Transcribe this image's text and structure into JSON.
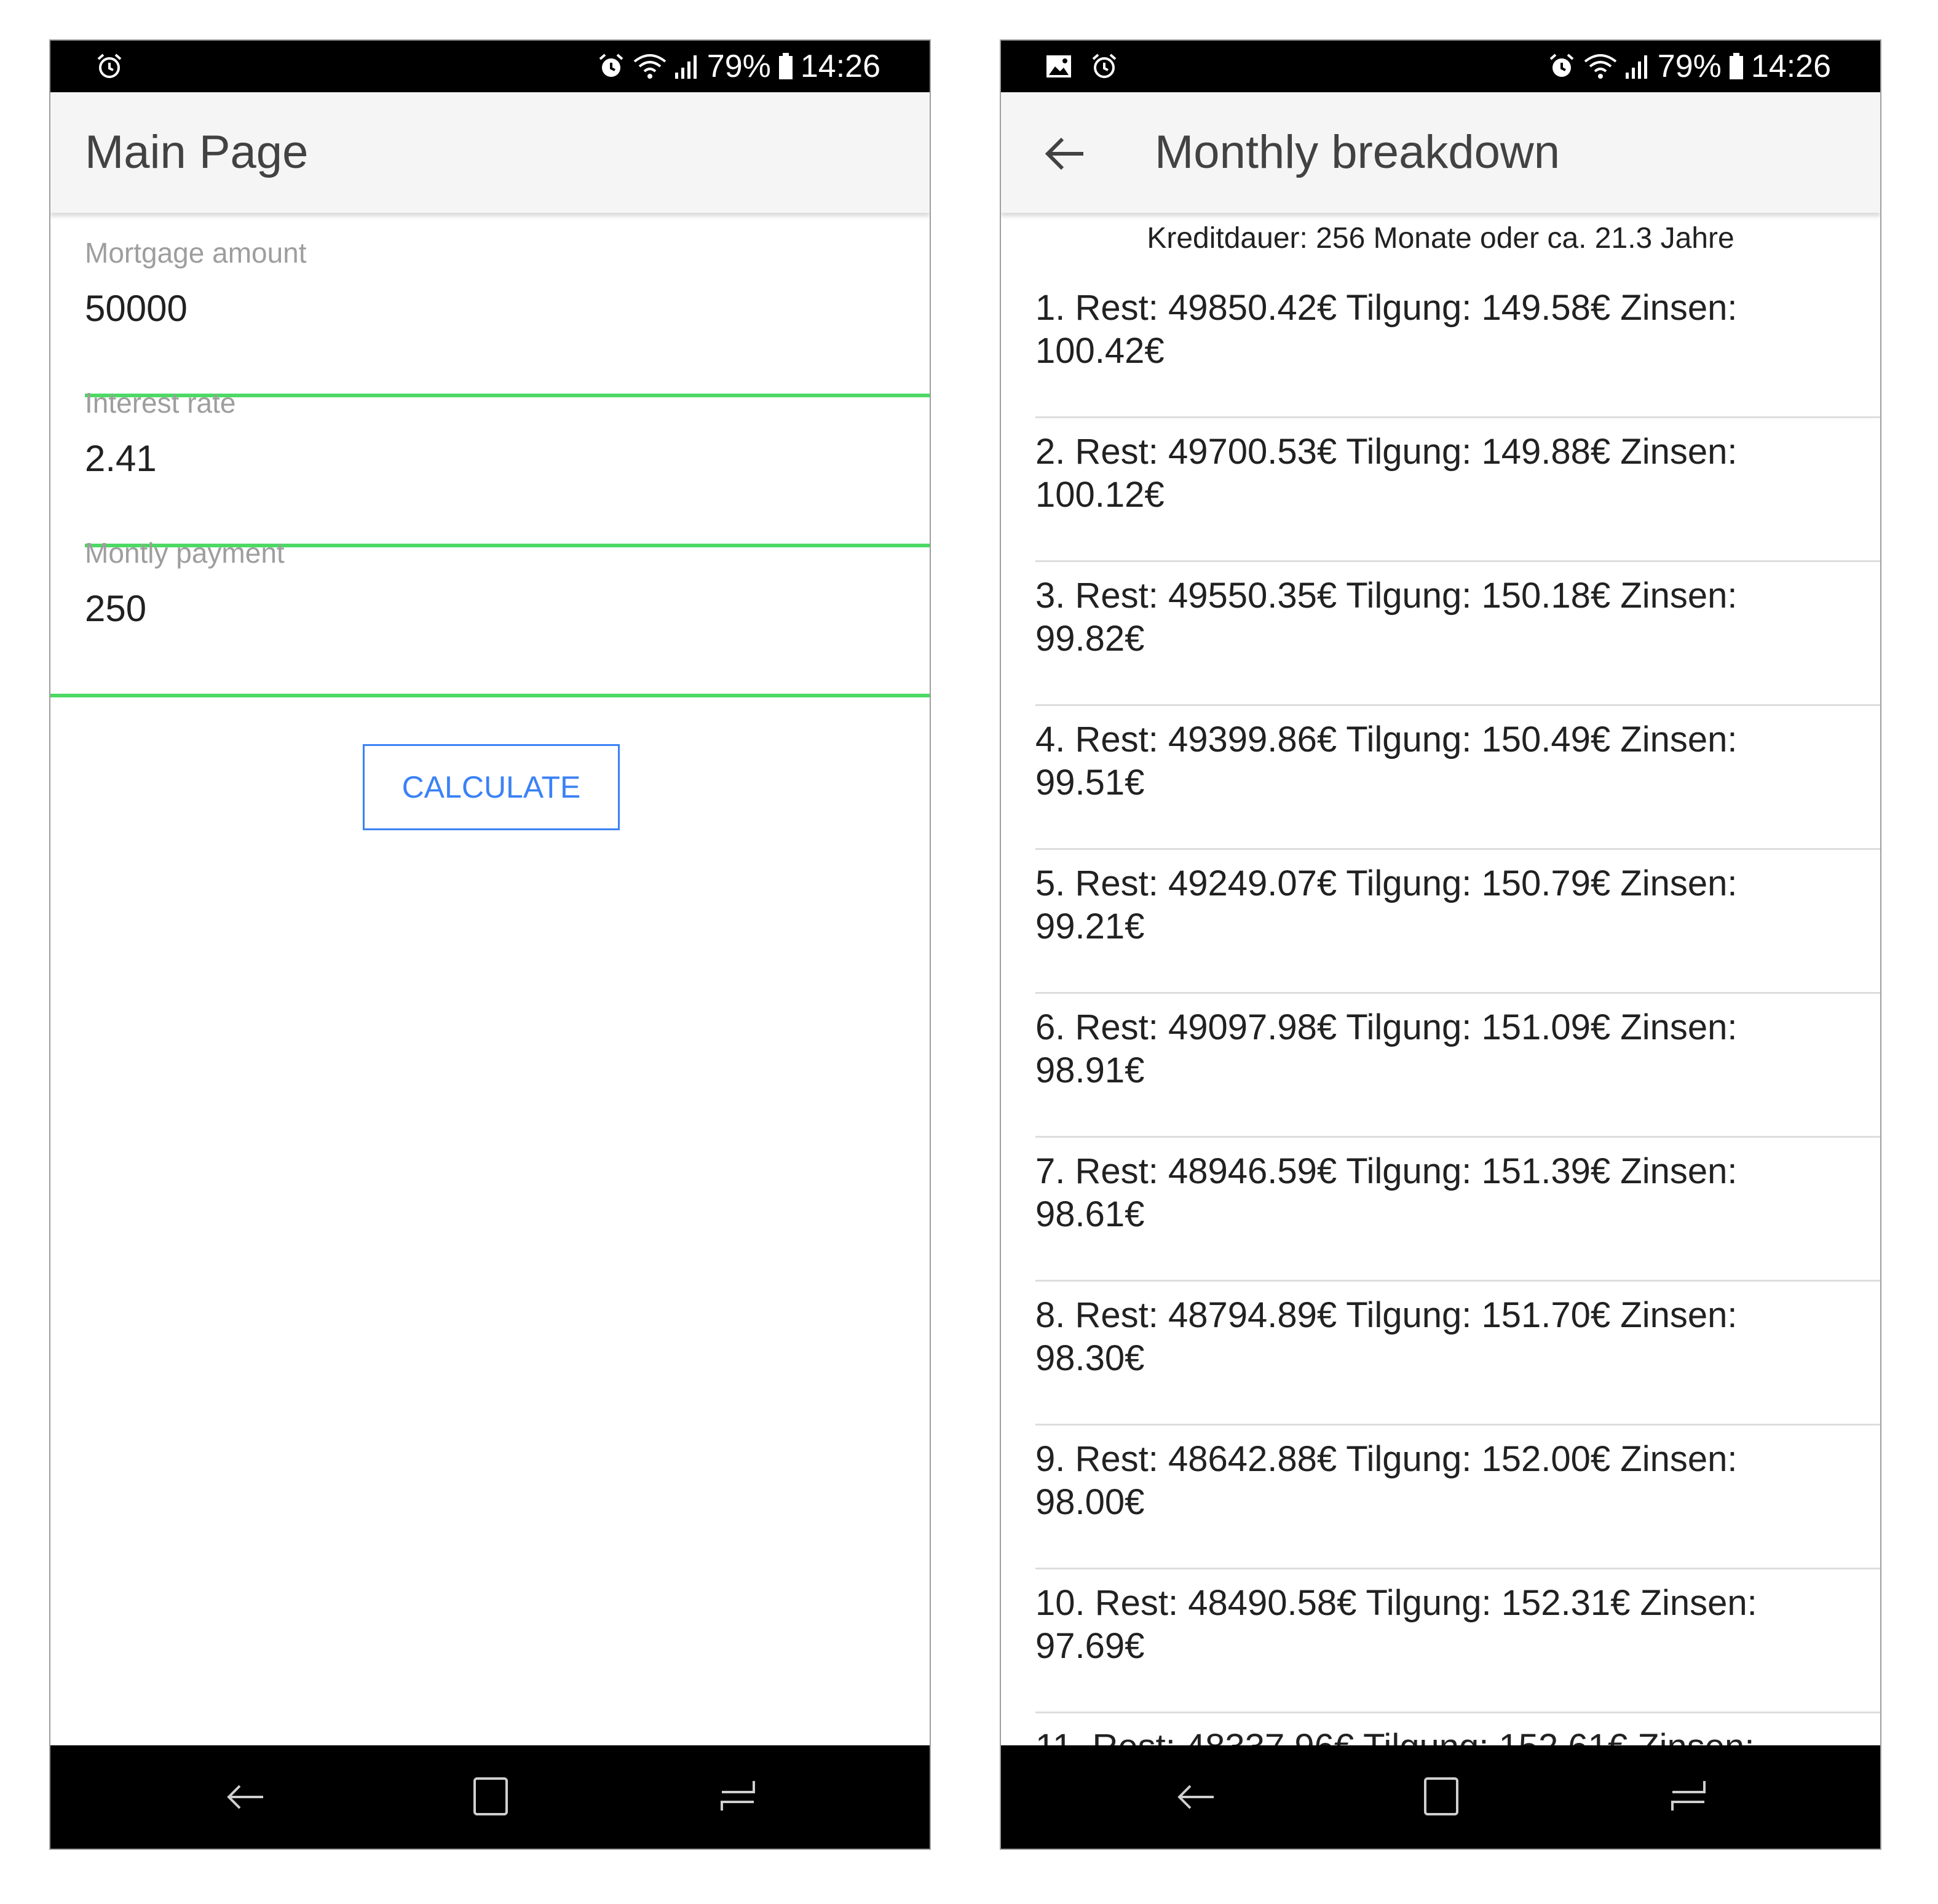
{
  "left_screen": {
    "status": {
      "battery": "79%",
      "time": "14:26"
    },
    "title": "Main Page",
    "fields": [
      {
        "label": "Mortgage amount",
        "value": "50000"
      },
      {
        "label": "Interest rate",
        "value": "2.41"
      },
      {
        "label": "Montly payment",
        "value": "250"
      }
    ],
    "calculate_label": "CALCULATE"
  },
  "right_screen": {
    "status": {
      "battery": "79%",
      "time": "14:26"
    },
    "title": "Monthly breakdown",
    "duration": "Kreditdauer: 256 Monate oder ca. 21.3 Jahre",
    "items": [
      "1. Rest: 49850.42€ Tilgung: 149.58€ Zinsen: 100.42€",
      "2. Rest: 49700.53€ Tilgung: 149.88€ Zinsen: 100.12€",
      "3. Rest: 49550.35€ Tilgung: 150.18€ Zinsen: 99.82€",
      "4. Rest: 49399.86€ Tilgung: 150.49€ Zinsen: 99.51€",
      "5. Rest: 49249.07€ Tilgung: 150.79€ Zinsen: 99.21€",
      "6. Rest: 49097.98€ Tilgung: 151.09€ Zinsen: 98.91€",
      "7. Rest: 48946.59€ Tilgung: 151.39€ Zinsen: 98.61€",
      "8. Rest: 48794.89€ Tilgung: 151.70€ Zinsen: 98.30€",
      "9. Rest: 48642.88€ Tilgung: 152.00€ Zinsen: 98.00€",
      "10. Rest: 48490.58€ Tilgung: 152.31€ Zinsen: 97.69€",
      "11. Rest: 48337.96€ Tilgung: 152.61€ Zinsen:"
    ]
  },
  "icons": [
    "alarm-icon",
    "gallery-icon",
    "wifi-icon",
    "signal-icon",
    "battery-icon",
    "back-arrow-icon",
    "nav-back-icon",
    "nav-home-icon",
    "nav-recent-icon"
  ],
  "colors": {
    "accent_line": "#4cd964",
    "button_blue": "#3b82f6",
    "bars": "#000000",
    "appbar": "#f5f5f5"
  }
}
